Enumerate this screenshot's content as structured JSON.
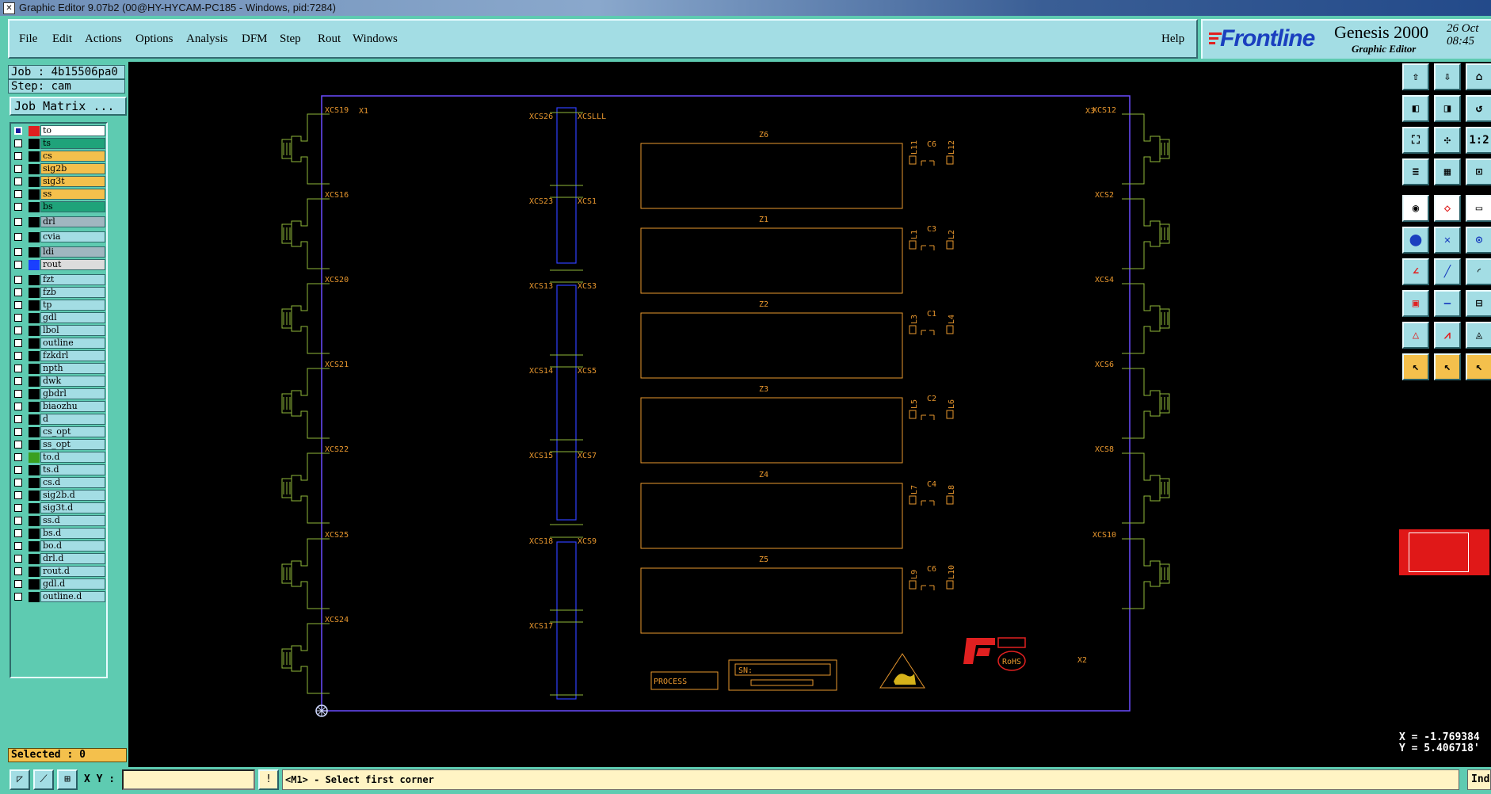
{
  "window": {
    "title": "Graphic Editor 9.07b2 (00@HY-HYCAM-PC185 - Windows, pid:7284)"
  },
  "menu": {
    "items": [
      "File",
      "Edit",
      "Actions",
      "Options",
      "Analysis",
      "DFM",
      "Step",
      "Rout",
      "Windows"
    ],
    "help": "Help"
  },
  "brand": {
    "logo": "Frontline",
    "product": "Genesis 2000",
    "subtitle": "Graphic Editor",
    "date": "26 Oct",
    "time": "08:45",
    "logo_color": "#1a3fbf",
    "logo_accent": "#e02020"
  },
  "job": {
    "job_label": "Job : 4b15506pa0",
    "step_label": "Step: cam",
    "matrix_button": "Job Matrix ..."
  },
  "layers": [
    {
      "name": "to",
      "color": "#ffffff",
      "swatch": "#e02020",
      "checked": true
    },
    {
      "name": "ts",
      "color": "#1fa37a"
    },
    {
      "name": "cs",
      "color": "#f4c04c"
    },
    {
      "name": "sig2b",
      "color": "#f4c04c"
    },
    {
      "name": "sig3t",
      "color": "#f4c04c"
    },
    {
      "name": "ss",
      "color": "#f4c04c"
    },
    {
      "name": "bs",
      "color": "#1fa37a"
    },
    {
      "name": "drl",
      "color": "#a0b6c0",
      "gap": true
    },
    {
      "name": "cvia",
      "color": "#a3dde4",
      "gap": true
    },
    {
      "name": "ldi",
      "color": "#a0b6c0",
      "gap": true
    },
    {
      "name": "rout",
      "color": "#dcdcdc",
      "swatch": "#1a3fff"
    },
    {
      "name": "fzt",
      "color": "#a3dde4",
      "gap": true
    },
    {
      "name": "fzb",
      "color": "#a3dde4"
    },
    {
      "name": "tp",
      "color": "#a3dde4"
    },
    {
      "name": "gdl",
      "color": "#a3dde4"
    },
    {
      "name": "lbol",
      "color": "#a3dde4"
    },
    {
      "name": "outline",
      "color": "#a3dde4"
    },
    {
      "name": "fzkdrl",
      "color": "#a3dde4"
    },
    {
      "name": "npth",
      "color": "#a3dde4"
    },
    {
      "name": "dwk",
      "color": "#a3dde4"
    },
    {
      "name": "gbdrl",
      "color": "#a3dde4"
    },
    {
      "name": "biaozhu",
      "color": "#a3dde4"
    },
    {
      "name": "d",
      "color": "#a3dde4"
    },
    {
      "name": "cs_opt",
      "color": "#a3dde4"
    },
    {
      "name": "ss_opt",
      "color": "#a3dde4"
    },
    {
      "name": "to.d",
      "color": "#a3dde4",
      "swatch": "#3aa020"
    },
    {
      "name": "ts.d",
      "color": "#a3dde4"
    },
    {
      "name": "cs.d",
      "color": "#a3dde4"
    },
    {
      "name": "sig2b.d",
      "color": "#a3dde4"
    },
    {
      "name": "sig3t.d",
      "color": "#a3dde4"
    },
    {
      "name": "ss.d",
      "color": "#a3dde4"
    },
    {
      "name": "bs.d",
      "color": "#a3dde4"
    },
    {
      "name": "bo.d",
      "color": "#a3dde4"
    },
    {
      "name": "drl.d",
      "color": "#a3dde4"
    },
    {
      "name": "rout.d",
      "color": "#a3dde4"
    },
    {
      "name": "gdl.d",
      "color": "#a3dde4"
    },
    {
      "name": "outline.d",
      "color": "#a3dde4"
    }
  ],
  "selected": "Selected : 0",
  "coords": {
    "x": "X = -1.769384",
    "y": "Y = 5.406718'"
  },
  "bottom": {
    "xy_label": "X Y :",
    "xy_value": "",
    "status": "<M1> - Select first corner",
    "ind": "Ind"
  },
  "board": {
    "corner_marks": [
      "X1",
      "X3",
      "X2"
    ],
    "connectors_left": [
      "XCS19",
      "XCS16",
      "XCS20",
      "XCS21",
      "XCS22",
      "XCS25",
      "XCS24"
    ],
    "connectors_right": [
      "XCS12",
      "XCS2",
      "XCS4",
      "XCS6",
      "XCS8",
      "XCS10"
    ],
    "mid_left": [
      "XCS26",
      "XCS23",
      "XCS13",
      "XCS14",
      "XCS15",
      "XCS18",
      "XCS17"
    ],
    "mid_right": [
      "XCSLLL",
      "XCS1",
      "XCS3",
      "XCS5",
      "XCS7",
      "XCS9"
    ],
    "modules": [
      "Z6",
      "Z1",
      "Z2",
      "Z3",
      "Z4",
      "Z5"
    ],
    "coil_pairs": [
      [
        "L11",
        "L12"
      ],
      [
        "L1",
        "L2"
      ],
      [
        "L3",
        "L4"
      ],
      [
        "L5",
        "L6"
      ],
      [
        "L7",
        "L8"
      ],
      [
        "L9",
        "L10"
      ]
    ],
    "caps": [
      "C6",
      "C3",
      "C1",
      "C2",
      "C4",
      "C6"
    ],
    "process_text": "PROCESS",
    "sn_text": "SN:",
    "rohs_text": "RoHS",
    "outline_color": "#6a4cff",
    "label_color": "#e8972e",
    "connector_color": "#8fb83a",
    "rout_color": "#2f3fff",
    "logo_color": "#e02020"
  },
  "tools": {
    "icons": [
      "open-layer-icon",
      "save-layer-icon",
      "home-icon",
      "move-left-icon",
      "move-right-icon",
      "undo-icon",
      "zoom-fit-icon",
      "zoom-center-icon",
      "scale-1-2-icon",
      "settings-icon",
      "grid-icon",
      "snap-icon",
      "camera-icon",
      "transform-icon",
      "ruler-icon",
      "connect-icon",
      "delete-icon",
      "add-point-icon",
      "line-icon",
      "slant-icon",
      "arc-icon",
      "pad-icon",
      "segment-icon",
      "measure-icon",
      "text-a-icon",
      "text-b-icon",
      "text-c-icon",
      "select-icon",
      "select-box-icon",
      "select-touch-icon"
    ],
    "labels": {
      "scale": "1:2"
    }
  }
}
